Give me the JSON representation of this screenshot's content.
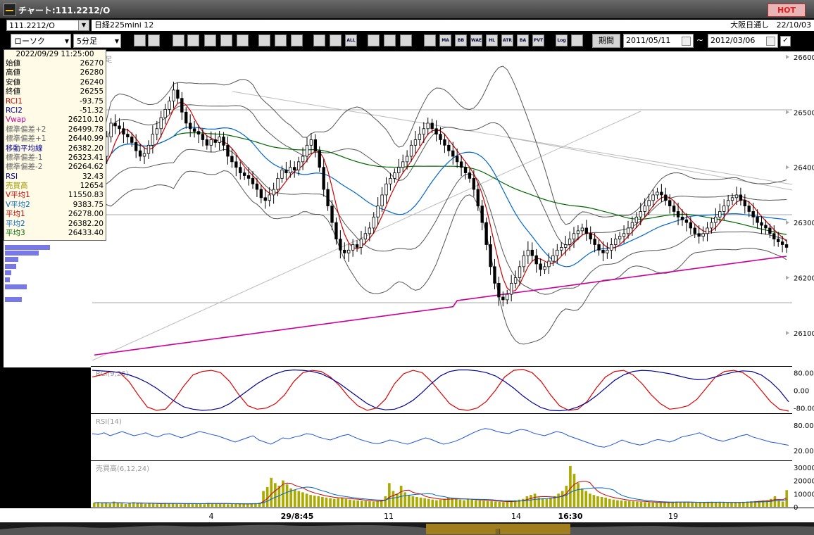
{
  "window": {
    "title": "チャート:111.2212/O",
    "hot_label": "HOT"
  },
  "toolbar": {
    "symbol": "111.2212/O",
    "instrument": "日経225mini 12",
    "exchange": "大阪日通し",
    "date": "22/10/03",
    "chart_type": "ローソク",
    "interval": "5分足",
    "period_button": "期間",
    "date_from": "2011/05/11",
    "date_to": "2012/03/06",
    "tilde": "~",
    "tool_icons": [
      "zoom-icon",
      "split-icon",
      "bull-icon",
      "q-icon",
      "bar-icon",
      "flag-icon",
      "warn-icon",
      "pen-icon",
      "cursor-icon",
      "undo-icon",
      "insert-left-icon",
      "insert-right-icon",
      "all-icon",
      "settings-icon",
      "tool-icon",
      "color-icon",
      "grid-icon",
      "ma-icon",
      "bb-icon",
      "wae-icon",
      "hl-icon",
      "atr-icon",
      "ba-icon",
      "pvt-icon",
      "log-icon",
      "chart-export-icon"
    ],
    "tool_labels": {
      "all": "ALL",
      "ma": "MA",
      "bb": "BB",
      "wae": "WAE",
      "hl": "HL",
      "atr": "ATR",
      "ba": "BA",
      "pvt": "PVT",
      "log": "Log"
    }
  },
  "info": {
    "datetime": "2022/09/29  11:25:00",
    "rows": [
      {
        "label": "始値",
        "value": "26270",
        "color": "#000000"
      },
      {
        "label": "高値",
        "value": "26280",
        "color": "#000000"
      },
      {
        "label": "安値",
        "value": "26240",
        "color": "#000000"
      },
      {
        "label": "終値",
        "value": "26255",
        "color": "#000000"
      },
      {
        "label": "RCI1",
        "value": "-93.75",
        "color": "#cc0000"
      },
      {
        "label": "RCI2",
        "value": "-51.32",
        "color": "#000099"
      },
      {
        "label": "Vwap",
        "value": "26210.10",
        "color": "#cc0099"
      },
      {
        "label": "標準偏差+2",
        "value": "26499.78",
        "color": "#666666"
      },
      {
        "label": "標準偏差+1",
        "value": "26440.99",
        "color": "#666666"
      },
      {
        "label": "移動平均線",
        "value": "26382.20",
        "color": "#000099"
      },
      {
        "label": "標準偏差-1",
        "value": "26323.41",
        "color": "#666666"
      },
      {
        "label": "標準偏差-2",
        "value": "26264.62",
        "color": "#666666"
      },
      {
        "label": "RSI",
        "value": "32.43",
        "color": "#000099"
      },
      {
        "label": "売買高",
        "value": "12654",
        "color": "#999900"
      },
      {
        "label": "V平均1",
        "value": "11550.83",
        "color": "#cc0000"
      },
      {
        "label": "V平均2",
        "value": "9383.75",
        "color": "#0066cc"
      },
      {
        "label": "平均1",
        "value": "26278.00",
        "color": "#cc0000"
      },
      {
        "label": "平均2",
        "value": "26382.20",
        "color": "#0066cc"
      },
      {
        "label": "平均3",
        "value": "26433.40",
        "color": "#006600"
      }
    ]
  },
  "volume_profile": [
    0.52,
    0.39,
    0.15,
    0.13,
    0.07,
    0.06,
    0.25,
    0.19
  ],
  "panels": {
    "main_label": "5分足",
    "rci_label": "RCI(9,26)",
    "rsi_label": "RSI(14)",
    "vol_label": "売買高(6,12,24)"
  },
  "chart_data": [
    {
      "type": "candlestick",
      "y_ticks": [
        26100,
        26200,
        26300,
        26400,
        26500,
        26600
      ],
      "ylim": [
        26040,
        26610
      ],
      "x_tick_labels": [
        "4",
        "29/8:45",
        "11",
        "14",
        "16:30",
        "19"
      ],
      "bars_count": 190,
      "ohlc_close_path": [
        26370,
        26395,
        26420,
        26455,
        26480,
        26475,
        26470,
        26460,
        26455,
        26445,
        26430,
        26420,
        26425,
        26440,
        26460,
        26470,
        26490,
        26505,
        26520,
        26540,
        26525,
        26500,
        26480,
        26470,
        26465,
        26460,
        26450,
        26440,
        26450,
        26445,
        26455,
        26440,
        26420,
        26410,
        26400,
        26390,
        26385,
        26380,
        26370,
        26360,
        26345,
        26340,
        26350,
        26360,
        26380,
        26395,
        26390,
        26400,
        26395,
        26410,
        26420,
        26440,
        26450,
        26430,
        26400,
        26360,
        26330,
        26300,
        26270,
        26250,
        26245,
        26250,
        26260,
        26255,
        26270,
        26280,
        26290,
        26310,
        26330,
        26350,
        26370,
        26380,
        26390,
        26400,
        26410,
        26420,
        26440,
        26450,
        26460,
        26470,
        26480,
        26470,
        26460,
        26450,
        26440,
        26430,
        26420,
        26410,
        26400,
        26390,
        26380,
        26360,
        26330,
        26300,
        26260,
        26220,
        26190,
        26165,
        26160,
        26170,
        26190,
        26200,
        26220,
        26240,
        26250,
        26240,
        26225,
        26215,
        26220,
        26230,
        26240,
        26250,
        26255,
        26260,
        26270,
        26280,
        26285,
        26290,
        26280,
        26270,
        26260,
        26250,
        26245,
        26250,
        26260,
        26270,
        26275,
        26280,
        26290,
        26300,
        26310,
        26320,
        26330,
        26340,
        26350,
        26355,
        26350,
        26340,
        26330,
        26320,
        26310,
        26305,
        26300,
        26290,
        26280,
        26275,
        26280,
        26290,
        26300,
        26310,
        26320,
        26330,
        26340,
        26345,
        26350,
        26340,
        26330,
        26320,
        26310,
        26300,
        26295,
        26290,
        26280,
        26270,
        26265,
        26260,
        26255
      ],
      "series": [
        {
          "name": "平均1",
          "color": "#cc0000"
        },
        {
          "name": "平均2",
          "color": "#0066cc"
        },
        {
          "name": "平均3",
          "color": "#006600"
        },
        {
          "name": "Vwap",
          "color": "#cc0099"
        },
        {
          "name": "標準偏差±1/±2",
          "color": "#555555"
        }
      ]
    },
    {
      "type": "line",
      "title": "RCI(9,26)",
      "y_ticks": [
        80.0,
        0.0,
        -80.0
      ],
      "y_tick_labels": [
        "80.00",
        "0.00",
        "-80.00"
      ],
      "ylim": [
        -100,
        100
      ],
      "series": [
        {
          "name": "RCI1",
          "color": "#dd0000",
          "values": [
            60,
            70,
            85,
            80,
            40,
            -20,
            -75,
            -90,
            -85,
            -40,
            20,
            70,
            85,
            90,
            80,
            40,
            -20,
            -70,
            -85,
            -80,
            -60,
            -20,
            40,
            80,
            90,
            85,
            60,
            20,
            -30,
            -70,
            -90,
            -80,
            -40,
            30,
            75,
            90,
            80,
            40,
            -10,
            -60,
            -85,
            -90,
            -80,
            -50,
            0,
            60,
            90,
            95,
            80,
            40,
            -20,
            -70,
            -90,
            -85,
            -50,
            10,
            60,
            85,
            90,
            70,
            30,
            -20,
            -60,
            -85,
            -80,
            -70,
            -40,
            10,
            60,
            85,
            90,
            80,
            50,
            0,
            -50,
            -85,
            -93.75
          ]
        },
        {
          "name": "RCI2",
          "color": "#000099",
          "values": [
            90,
            88,
            85,
            80,
            70,
            55,
            35,
            10,
            -20,
            -50,
            -75,
            -85,
            -90,
            -88,
            -80,
            -60,
            -30,
            0,
            30,
            55,
            75,
            88,
            92,
            90,
            85,
            75,
            55,
            30,
            0,
            -30,
            -60,
            -80,
            -88,
            -85,
            -70,
            -45,
            -10,
            30,
            65,
            85,
            92,
            92,
            88,
            80,
            65,
            40,
            10,
            -25,
            -55,
            -78,
            -90,
            -92,
            -88,
            -75,
            -55,
            -25,
            10,
            45,
            70,
            85,
            90,
            88,
            82,
            75,
            65,
            55,
            48,
            50,
            60,
            72,
            82,
            88,
            85,
            70,
            40,
            0,
            -51.32
          ]
        }
      ]
    },
    {
      "type": "line",
      "title": "RSI(14)",
      "y_ticks": [
        80.0,
        20.0
      ],
      "y_tick_labels": [
        "80.00",
        "20.00"
      ],
      "ylim": [
        0,
        100
      ],
      "series": [
        {
          "name": "RSI",
          "color": "#2255dd",
          "values": [
            60,
            58,
            62,
            55,
            60,
            65,
            60,
            55,
            58,
            62,
            56,
            52,
            58,
            60,
            55,
            50,
            55,
            60,
            65,
            62,
            58,
            55,
            50,
            45,
            40,
            45,
            50,
            55,
            45,
            40,
            35,
            42,
            50,
            48,
            52,
            55,
            60,
            58,
            52,
            48,
            45,
            50,
            55,
            58,
            52,
            46,
            42,
            38,
            36,
            40,
            45,
            42,
            38,
            35,
            40,
            45,
            50,
            46,
            40,
            35,
            38,
            42,
            48,
            55,
            62,
            68,
            72,
            70,
            65,
            62,
            60,
            66,
            70,
            68,
            62,
            58,
            55,
            60,
            65,
            62,
            55,
            50,
            45,
            40,
            35,
            30,
            28,
            32,
            38,
            45,
            40,
            36,
            33,
            36,
            42,
            46,
            44,
            40,
            45,
            52,
            55,
            58,
            62,
            56,
            50,
            45,
            42,
            46,
            50,
            55,
            58,
            52,
            48,
            44,
            40,
            38,
            35,
            32.43
          ]
        }
      ]
    },
    {
      "type": "bar",
      "title": "売買高(6,12,24)",
      "y_ticks": [
        30000,
        20000,
        10000,
        0
      ],
      "y_tick_labels": [
        "30000",
        "20000",
        "10000",
        "0"
      ],
      "ylim": [
        0,
        32000
      ],
      "series": [
        {
          "name": "売買高",
          "color": "#aaaa00",
          "values": [
            3000,
            3500,
            2800,
            3200,
            2500,
            4000,
            3000,
            2600,
            2200,
            2800,
            3500,
            3000,
            2500,
            2200,
            2600,
            2400,
            2000,
            2800,
            3000,
            2600,
            2400,
            2200,
            2000,
            2500,
            2800,
            2600,
            2400,
            2200,
            2000,
            3000,
            2800,
            2600,
            2400,
            2200,
            2000,
            2500,
            2400,
            2200,
            2100,
            2000,
            2500,
            2800,
            3200,
            12000,
            15000,
            22000,
            18000,
            16000,
            20000,
            17000,
            14000,
            13000,
            12000,
            11000,
            10000,
            9000,
            8500,
            8000,
            7500,
            7000,
            6500,
            6000,
            6500,
            7000,
            6000,
            5500,
            5000,
            4800,
            4600,
            4400,
            4200,
            4000,
            4500,
            5000,
            8000,
            18000,
            12000,
            10000,
            16000,
            11000,
            9000,
            8000,
            7500,
            7000,
            6500,
            6000,
            5500,
            5000,
            5500,
            6000,
            7000,
            6500,
            6000,
            5500,
            5000,
            6000,
            5500,
            5000,
            4800,
            4600,
            4400,
            4200,
            4000,
            3800,
            3600,
            4000,
            4500,
            5000,
            5500,
            6000,
            8000,
            9000,
            10000,
            7000,
            6500,
            6000,
            7000,
            8000,
            10000,
            12000,
            16000,
            31000,
            25000,
            18000,
            14000,
            12000,
            10000,
            9000,
            8000,
            7500,
            7000,
            6000,
            5500,
            5000,
            4800,
            4600,
            4400,
            4200,
            4000,
            3800,
            3600,
            3400,
            3200,
            3000,
            3200,
            3400,
            3600,
            3800,
            4000,
            3800,
            3600,
            3400,
            3200,
            3000,
            3200,
            3400,
            3600,
            3800,
            3600,
            3400,
            3200,
            3000,
            3200,
            3400,
            3600,
            3800,
            4000,
            4200,
            4400,
            4600,
            4800,
            5000,
            6000,
            8000,
            5000,
            4000,
            12654
          ]
        },
        {
          "name": "V平均1",
          "color": "#cc0000"
        },
        {
          "name": "V平均2",
          "color": "#0066cc"
        }
      ]
    }
  ],
  "scrollbar": {
    "thumb_label": "|||"
  }
}
